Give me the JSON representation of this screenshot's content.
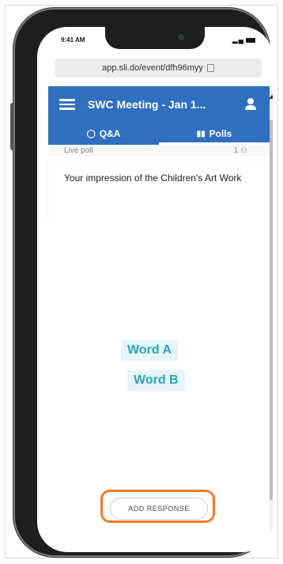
{
  "status_bar": {
    "time": "9:41 AM",
    "icons": "◆ ≡"
  },
  "browser": {
    "url": "app.sli.do/event/dfh96myy"
  },
  "header": {
    "title": "SWC Meeting - Jan 1...",
    "menu_icon": "hamburger-icon",
    "user_icon": "user-icon"
  },
  "tabs": [
    {
      "label": "Q&A",
      "icon": "🗨",
      "active": false
    },
    {
      "label": "Polls",
      "icon": "▇",
      "active": true
    }
  ],
  "poll": {
    "label": "Live poll",
    "participants": "1 ⚇",
    "question": "Your impression of the Children's Art Work",
    "words": [
      "Word A",
      "Word B"
    ],
    "add_response_label": "ADD RESPONSE"
  },
  "colors": {
    "header_bg": "#2f6fbf",
    "word_text": "#2aa6b8",
    "word_bg": "#e6f5f7",
    "highlight": "#f07a22"
  }
}
